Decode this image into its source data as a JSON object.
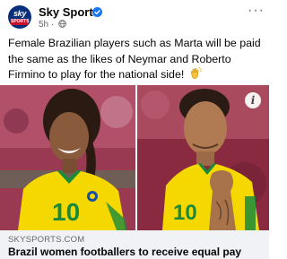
{
  "post": {
    "page_name": "Sky Sports",
    "avatar_text": "sky",
    "avatar_subtext": "SPORTS",
    "time": "5h",
    "dot": "·",
    "more_label": "···",
    "text": "Female Brazilian players such as Marta will be paid the same as the likes of Neymar and Roberto Firmino to play for the national side!",
    "emoji": "clapping-hands-icon"
  },
  "photos": {
    "left_shirt_number": "10",
    "right_shirt_number": "10",
    "info_label": "i"
  },
  "link": {
    "domain": "SKYSPORTS.COM",
    "headline": "Brazil women footballers to receive equal pay"
  },
  "colors": {
    "brand_blue": "#0a2f7a",
    "verified_blue": "#1877f2",
    "brazil_yellow": "#f5d800",
    "brazil_green": "#1a8a3a",
    "card_background": "#f0f2f5"
  }
}
